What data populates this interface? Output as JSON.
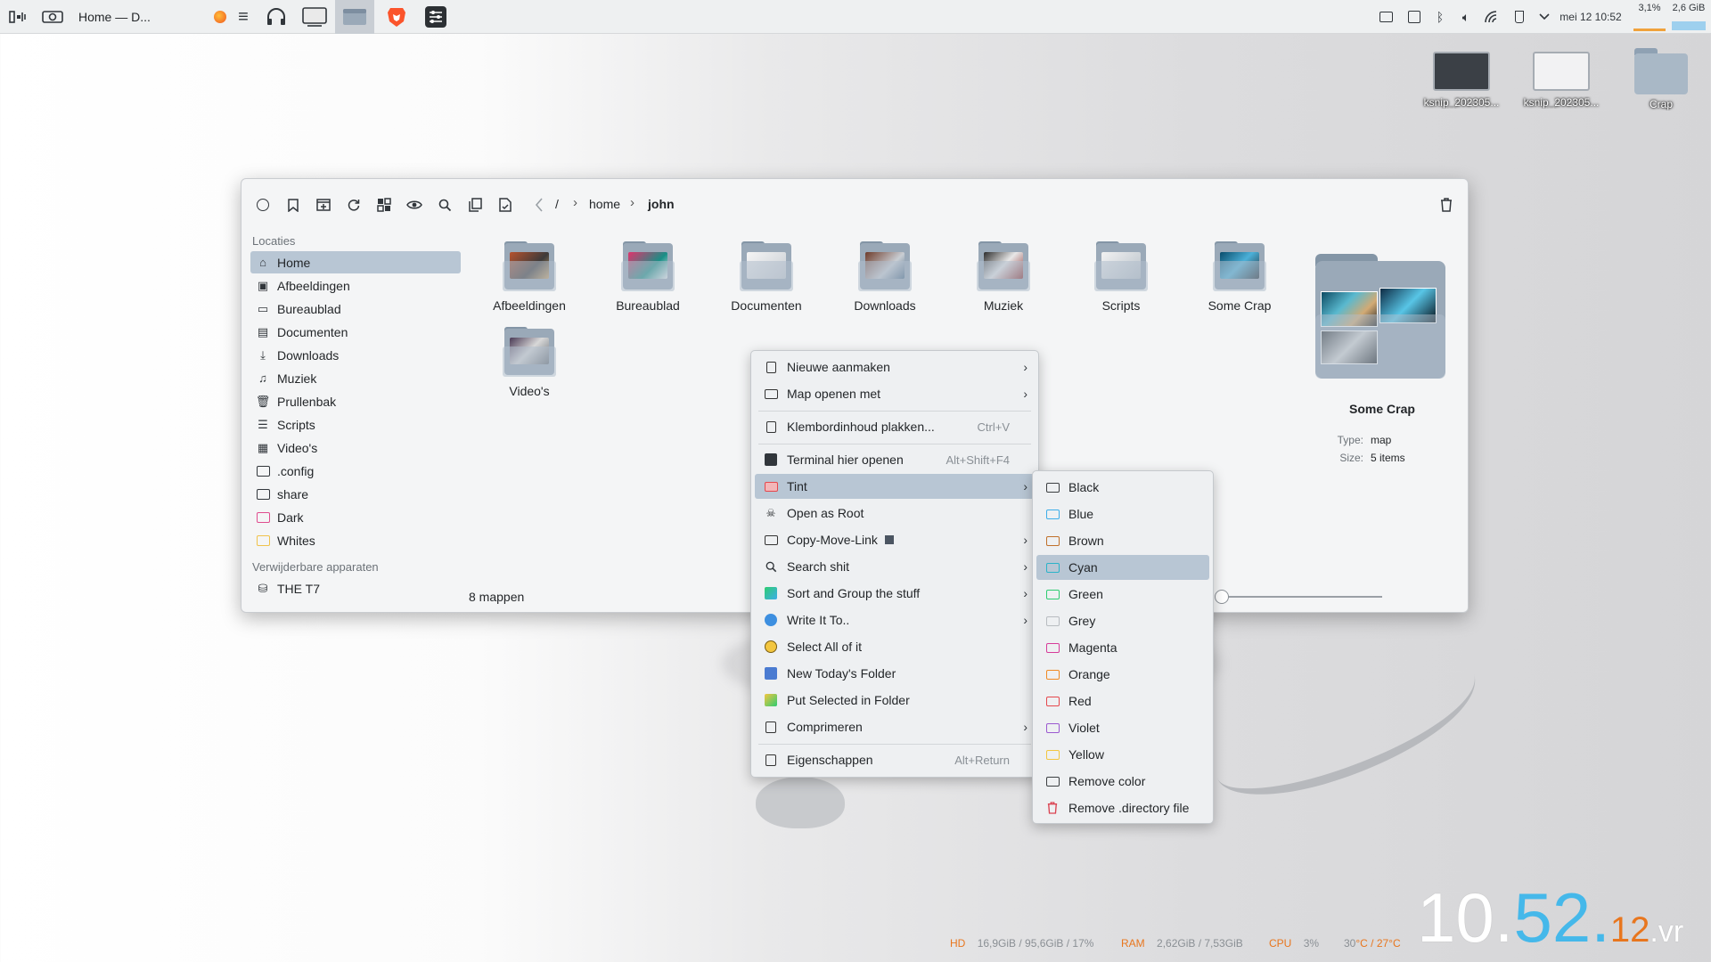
{
  "panel": {
    "window_title": "Home — D...",
    "tray": {
      "clock": "mei 12 10:52",
      "cpu": "3,1%",
      "mem": "2,6 GiB"
    }
  },
  "desktop": {
    "icons": [
      {
        "label": "ksnip_202305..."
      },
      {
        "label": "ksnip_202305..."
      },
      {
        "label": "Crap"
      }
    ]
  },
  "filemanager": {
    "breadcrumb": {
      "root": "/",
      "parts": [
        "home",
        "john"
      ]
    },
    "sidebar": {
      "places_header": "Locaties",
      "places": [
        "Home",
        "Afbeeldingen",
        "Bureaublad",
        "Documenten",
        "Downloads",
        "Muziek",
        "Prullenbak",
        "Scripts",
        "Video's",
        ".config",
        "share",
        "Dark",
        "Whites"
      ],
      "removable_header": "Verwijderbare apparaten",
      "removable": [
        "THE T7"
      ]
    },
    "folders": [
      "Afbeeldingen",
      "Bureaublad",
      "Documenten",
      "Downloads",
      "Muziek",
      "Scripts",
      "Some Crap",
      "Video's"
    ],
    "status": "8 mappen",
    "preview": {
      "name": "Some Crap",
      "type_label": "Type:",
      "type_value": "map",
      "size_label": "Size:",
      "size_value": "5 items"
    }
  },
  "context_menu": {
    "items": [
      {
        "label": "Nieuwe aanmaken",
        "shortcut": "",
        "submenu": true
      },
      {
        "label": "Map openen met",
        "shortcut": "",
        "submenu": true
      },
      {
        "label": "Klembordinhoud plakken...",
        "shortcut": "Ctrl+V",
        "submenu": false
      },
      {
        "label": "Terminal hier openen",
        "shortcut": "Alt+Shift+F4",
        "submenu": false
      },
      {
        "label": "Tint",
        "shortcut": "",
        "submenu": true
      },
      {
        "label": "Open as Root",
        "shortcut": "",
        "submenu": false
      },
      {
        "label": "Copy-Move-Link",
        "shortcut": "",
        "submenu": true
      },
      {
        "label": "Search shit",
        "shortcut": "",
        "submenu": true
      },
      {
        "label": "Sort and Group the stuff",
        "shortcut": "",
        "submenu": true
      },
      {
        "label": "Write It To..",
        "shortcut": "",
        "submenu": true
      },
      {
        "label": "Select All of it",
        "shortcut": "",
        "submenu": false
      },
      {
        "label": "New Today's Folder",
        "shortcut": "",
        "submenu": false
      },
      {
        "label": "Put Selected in Folder",
        "shortcut": "",
        "submenu": false
      },
      {
        "label": "Comprimeren",
        "shortcut": "",
        "submenu": true
      },
      {
        "label": "Eigenschappen",
        "shortcut": "Alt+Return",
        "submenu": false
      }
    ]
  },
  "tint_submenu": {
    "items": [
      {
        "label": "Black",
        "color": "#3c3f42"
      },
      {
        "label": "Blue",
        "color": "#3daee9"
      },
      {
        "label": "Brown",
        "color": "#c0702a"
      },
      {
        "label": "Cyan",
        "color": "#2ab3c9"
      },
      {
        "label": "Green",
        "color": "#2ecc71"
      },
      {
        "label": "Grey",
        "color": "#b8bcc0"
      },
      {
        "label": "Magenta",
        "color": "#d63c9a"
      },
      {
        "label": "Orange",
        "color": "#f08a24"
      },
      {
        "label": "Red",
        "color": "#e5484d"
      },
      {
        "label": "Violet",
        "color": "#9b59d0"
      },
      {
        "label": "Yellow",
        "color": "#f3c640"
      },
      {
        "label": "Remove color",
        "color": "#3c3f42"
      },
      {
        "label": "Remove .directory file",
        "color": "#da4453"
      }
    ]
  },
  "conky": {
    "hd_label": "HD",
    "hd_value": "16,9GiB / 95,6GiB / 17%",
    "ram_label": "RAM",
    "ram_value": "2,62GiB / 7,53GiB",
    "cpu_label": "CPU",
    "cpu_value": "3%",
    "temp_a": "30",
    "temp_b": "°C / 27°C"
  },
  "clock": {
    "hour": "10",
    "dot1": ".",
    "minute": "52",
    "dot2": ".",
    "second": "12",
    "suffix": ".vr"
  }
}
